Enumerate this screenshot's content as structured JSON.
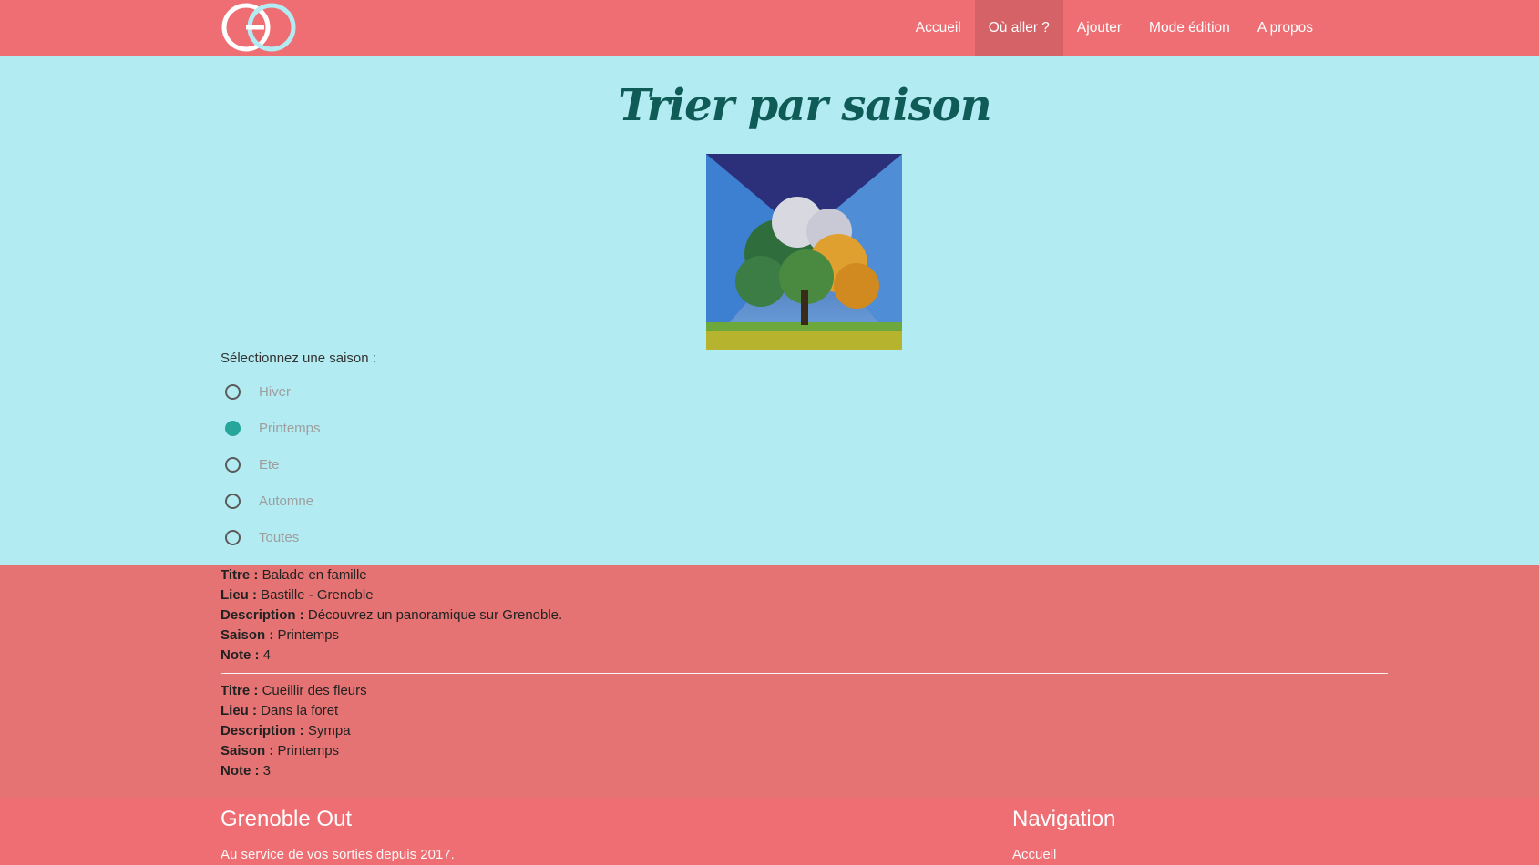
{
  "navbar": {
    "logo_text": "GO",
    "items": [
      {
        "label": "Accueil",
        "active": false
      },
      {
        "label": "Où aller ?",
        "active": true
      },
      {
        "label": "Ajouter",
        "active": false
      },
      {
        "label": "Mode édition",
        "active": false
      },
      {
        "label": "A propos",
        "active": false
      }
    ]
  },
  "main": {
    "title": "Trier par saison",
    "select_label": "Sélectionnez une saison :",
    "options": [
      {
        "label": "Hiver",
        "checked": false
      },
      {
        "label": "Printemps",
        "checked": true
      },
      {
        "label": "Ete",
        "checked": false
      },
      {
        "label": "Automne",
        "checked": false
      },
      {
        "label": "Toutes",
        "checked": false
      }
    ]
  },
  "results": [
    {
      "titre_label": "Titre :",
      "titre": "Balade en famille",
      "lieu_label": "Lieu :",
      "lieu": "Bastille - Grenoble",
      "description_label": "Description :",
      "description": "Découvrez un panoramique sur Grenoble.",
      "saison_label": "Saison :",
      "saison": "Printemps",
      "note_label": "Note :",
      "note": "4"
    },
    {
      "titre_label": "Titre :",
      "titre": "Cueillir des fleurs",
      "lieu_label": "Lieu :",
      "lieu": "Dans la foret",
      "description_label": "Description :",
      "description": "Sympa",
      "saison_label": "Saison :",
      "saison": "Printemps",
      "note_label": "Note :",
      "note": "3"
    }
  ],
  "footer": {
    "title": "Grenoble Out",
    "text": "Au service de vos sorties depuis 2017.",
    "nav_title": "Navigation",
    "nav_link": "Accueil"
  },
  "colors": {
    "navbar": "#ee6e73",
    "main_bg": "#b3ebf2",
    "results_bg": "#e57373",
    "title": "#0f5b57",
    "radio_checked": "#26a69a"
  }
}
